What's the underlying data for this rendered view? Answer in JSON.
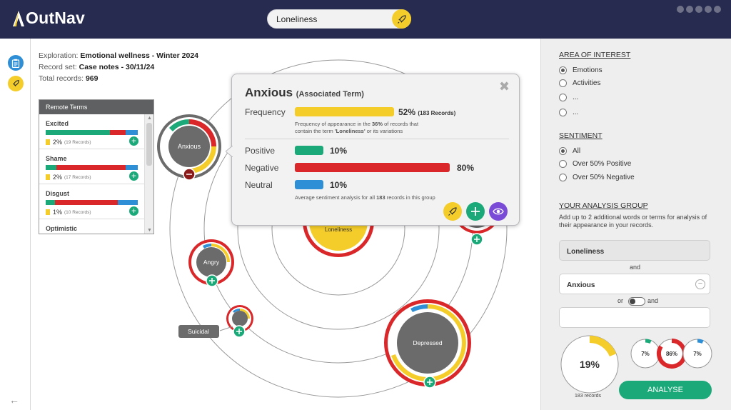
{
  "app": {
    "name": "OutNav"
  },
  "search": {
    "value": "Loneliness"
  },
  "exploration": {
    "exploration_label": "Exploration:",
    "exploration_value": "Emotional wellness - Winter 2024",
    "recordset_label": "Record set:",
    "recordset_value": "Case notes - 30/11/24",
    "total_label": "Total records:",
    "total_value": "969"
  },
  "remote_terms": {
    "title": "Remote Terms",
    "items": [
      {
        "name": "Excited",
        "pct": "2%",
        "records": "(19 Records)",
        "sentiment": [
          0.7,
          0.17,
          0.13
        ]
      },
      {
        "name": "Shame",
        "pct": "2%",
        "records": "(17 Records)",
        "sentiment": [
          0.12,
          0.75,
          0.13
        ]
      },
      {
        "name": "Disgust",
        "pct": "1%",
        "records": "(10 Records)",
        "sentiment": [
          0.1,
          0.68,
          0.22
        ]
      },
      {
        "name": "Optimistic"
      }
    ]
  },
  "map": {
    "center_label": "Loneliness",
    "nodes": {
      "anxious": "Anxious",
      "angry": "Angry",
      "suicidal": "Suicidal",
      "depressed": "Depressed"
    }
  },
  "popup": {
    "title": "Anxious",
    "subtitle": "(Associated Term)",
    "frequency_label": "Frequency",
    "frequency_value": "52%",
    "frequency_records": "(183 Records)",
    "frequency_fraction": 0.52,
    "frequency_note_1": "Frequency of appearance in the",
    "frequency_note_pct": "36%",
    "frequency_note_2": "of records that",
    "frequency_note_3": "contain the term",
    "frequency_note_term": "'Loneliness'",
    "frequency_note_4": "or its variations",
    "positive_label": "Positive",
    "positive_value": "10%",
    "negative_label": "Negative",
    "negative_value": "80%",
    "neutral_label": "Neutral",
    "neutral_value": "10%",
    "sentiment_note_1": "Average sentiment analysis for all",
    "sentiment_note_count": "183",
    "sentiment_note_2": "records in this group"
  },
  "sidebar": {
    "area_heading": "AREA OF INTEREST",
    "area_options": [
      "Emotions",
      "Activities",
      "...",
      "..."
    ],
    "sentiment_heading": "SENTIMENT",
    "sentiment_options": [
      "All",
      "Over 50% Positive",
      "Over 50% Negative"
    ],
    "group_heading": "YOUR ANALYSIS GROUP",
    "group_desc": "Add up to 2 additional words or terms for analysis of their appearance in your records.",
    "term1": "Loneliness",
    "and1": "and",
    "term2": "Anxious",
    "or_label": "or",
    "and2": "and",
    "term3": "",
    "big_pct": "19%",
    "big_fraction": 0.19,
    "records_label": "183 records",
    "positive_pct": "7%",
    "negative_pct": "86%",
    "neutral_pct": "7%",
    "analyse_label": "ANALYSE"
  },
  "colors": {
    "header_bg": "#262b4f",
    "accent_yellow": "#f5cd2a",
    "positive": "#1ba97a",
    "negative": "#d9272a",
    "neutral": "#2e8fd6",
    "node_grey": "#6b6b6b",
    "purple": "#7a4bd6"
  }
}
